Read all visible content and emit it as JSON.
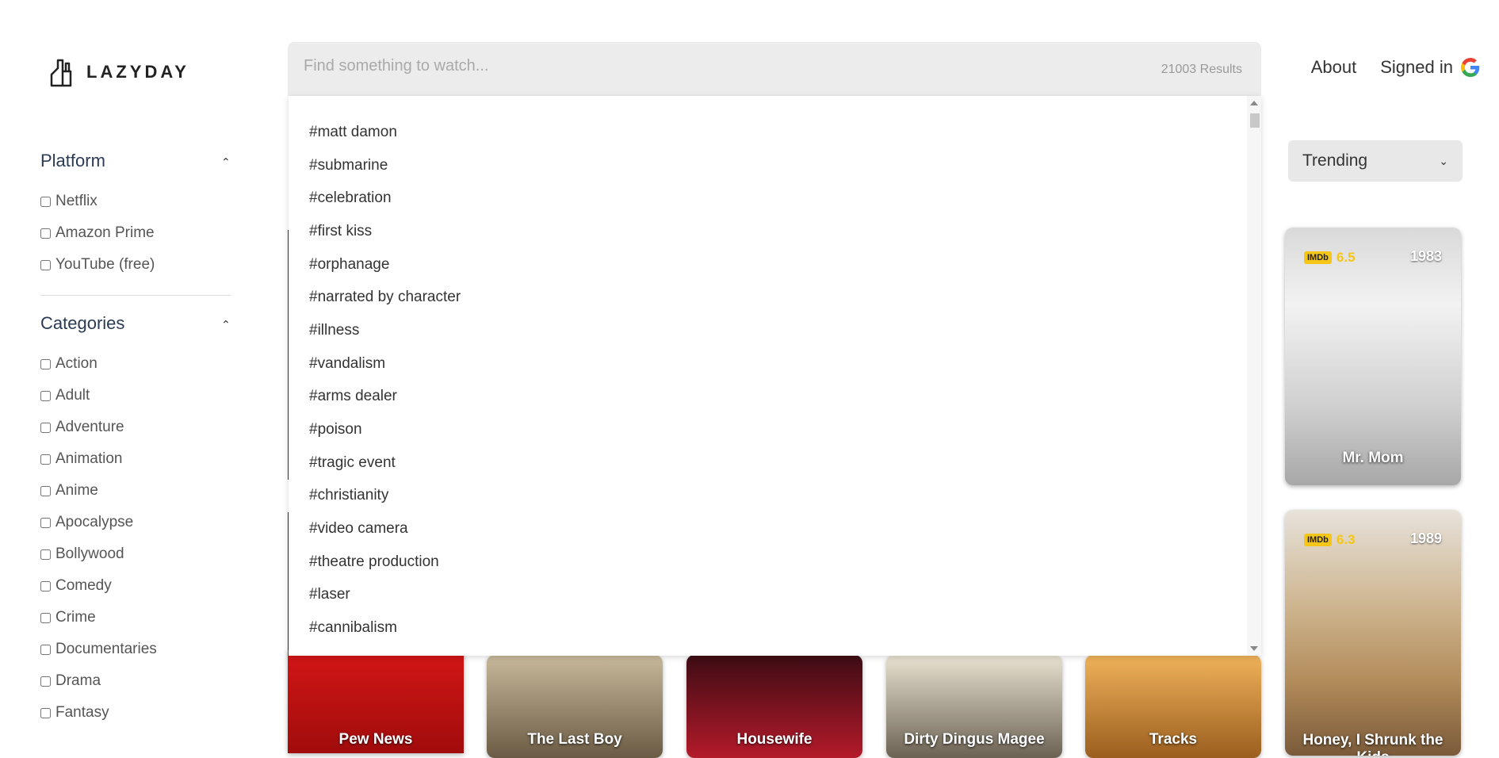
{
  "brand": {
    "name": "LAZYDAY"
  },
  "nav": {
    "about": "About",
    "signed_in": "Signed in"
  },
  "search": {
    "placeholder": "Find something to watch...",
    "results": "21003 Results"
  },
  "sort": {
    "selected": "Trending"
  },
  "sidebar": {
    "platform": {
      "title": "Platform",
      "items": [
        "Netflix",
        "Amazon Prime",
        "YouTube (free)"
      ]
    },
    "categories": {
      "title": "Categories",
      "items": [
        "Action",
        "Adult",
        "Adventure",
        "Animation",
        "Anime",
        "Apocalypse",
        "Bollywood",
        "Comedy",
        "Crime",
        "Documentaries",
        "Drama",
        "Fantasy"
      ]
    }
  },
  "dropdown": {
    "items": [
      "#matt damon",
      "#submarine",
      "#celebration",
      "#first kiss",
      "#orphanage",
      "#narrated by character",
      "#illness",
      "#vandalism",
      "#arms dealer",
      "#poison",
      "#tragic event",
      "#christianity",
      "#video camera",
      "#theatre production",
      "#laser",
      "#cannibalism"
    ]
  },
  "cards": {
    "mr_mom": {
      "title": "Mr. Mom",
      "imdb_label": "IMDb",
      "rating": "6.5",
      "year": "1983"
    },
    "honey": {
      "title": "Honey, I Shrunk the Kids",
      "imdb_label": "IMDb",
      "rating": "6.3",
      "year": "1989"
    },
    "pew_news": {
      "title": "Pew News"
    },
    "last_boy": {
      "title": "The Last Boy"
    },
    "housewife": {
      "title": "Housewife"
    },
    "dingus": {
      "title": "Dirty Dingus Magee"
    },
    "tracks": {
      "title": "Tracks"
    }
  },
  "colors": {
    "imdb": "#f5c518",
    "accent": "#2b3a55"
  }
}
